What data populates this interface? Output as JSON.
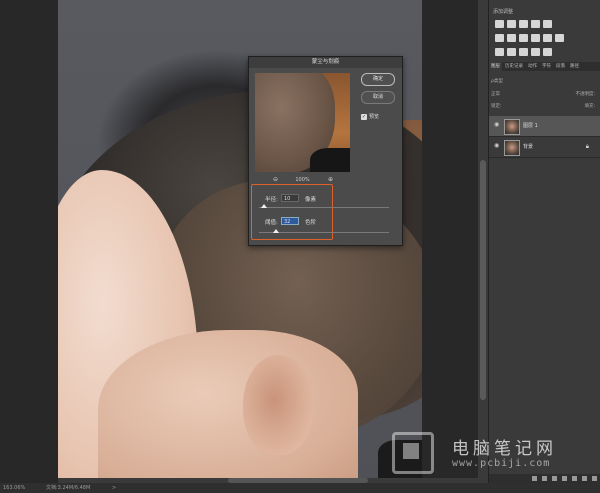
{
  "adjustments": {
    "title": "添加调整"
  },
  "layers_panel": {
    "tabs": [
      "图层",
      "历史记录",
      "动作",
      "字符",
      "段落",
      "路径"
    ],
    "kind_label": "ρ类型",
    "mode_label": "正常",
    "opacity_label": "不透明度:",
    "lock_label": "锁定:",
    "fill_label": "填充:",
    "layers": [
      {
        "name": "图层 1",
        "selected": true
      },
      {
        "name": "背景",
        "selected": false,
        "locked": true
      }
    ]
  },
  "dialog": {
    "title": "蒙尘与划痕",
    "ok_label": "确定",
    "cancel_label": "取消",
    "preview_label": "预览",
    "preview_checked": true,
    "zoom_label": "100%",
    "radius_label": "半径:",
    "radius_value": "10",
    "radius_unit": "像素",
    "threshold_label": "阈值:",
    "threshold_value": "32",
    "threshold_unit": "色阶",
    "radius_fraction": 0.04,
    "threshold_fraction": 0.13
  },
  "status": {
    "zoom": "163.06%",
    "doc": "文档:3.24M/6.48M",
    "arrow": ">"
  },
  "watermark": {
    "name": "电脑笔记网",
    "url": "www.pcbiji.com"
  },
  "colors": {
    "accent_highlight": "#e0602a",
    "selection": "#2e5aa0"
  }
}
